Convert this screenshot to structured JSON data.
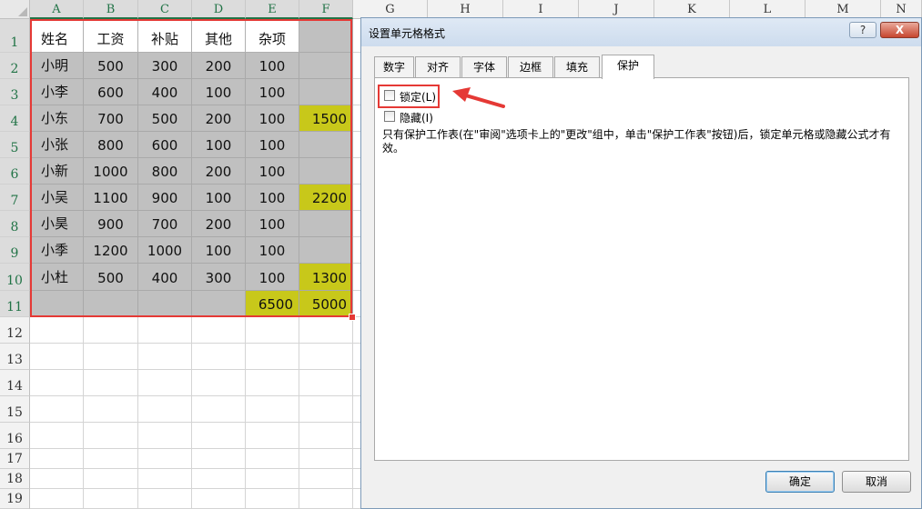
{
  "sheet": {
    "columns": [
      "A",
      "B",
      "C",
      "D",
      "E",
      "F",
      "G",
      "H",
      "I",
      "J",
      "K",
      "L",
      "M",
      "N"
    ],
    "rows": [
      "1",
      "2",
      "3",
      "4",
      "5",
      "6",
      "7",
      "8",
      "9",
      "10",
      "11",
      "12",
      "13",
      "14",
      "15",
      "16",
      "17",
      "18",
      "19"
    ],
    "cells": [
      [
        "姓名",
        "工资",
        "补贴",
        "其他",
        "杂项",
        ""
      ],
      [
        "小明",
        "500",
        "300",
        "200",
        "100",
        ""
      ],
      [
        "小李",
        "600",
        "400",
        "100",
        "100",
        ""
      ],
      [
        "小东",
        "700",
        "500",
        "200",
        "100",
        "1500"
      ],
      [
        "小张",
        "800",
        "600",
        "100",
        "100",
        ""
      ],
      [
        "小新",
        "1000",
        "800",
        "200",
        "100",
        ""
      ],
      [
        "小吴",
        "1100",
        "900",
        "100",
        "100",
        "2200"
      ],
      [
        "小昊",
        "900",
        "700",
        "200",
        "100",
        ""
      ],
      [
        "小季",
        "1200",
        "1000",
        "100",
        "100",
        ""
      ],
      [
        "小杜",
        "500",
        "400",
        "300",
        "100",
        "1300"
      ],
      [
        "",
        "",
        "",
        "",
        "6500",
        "5000"
      ]
    ],
    "colors": {
      "selection_fill": "#c0c0c0",
      "highlight": "#c8c81a",
      "selection_border": "#e53935",
      "arrow": "#e53935"
    }
  },
  "dialog": {
    "title": "设置单元格格式",
    "help": "?",
    "close": "X",
    "tabs": [
      "数字",
      "对齐",
      "字体",
      "边框",
      "填充",
      "保护"
    ],
    "active_tab": "保护",
    "locked_label": "锁定(L)",
    "locked_checked": false,
    "hidden_label": "隐藏(I)",
    "hidden_checked": false,
    "description": "只有保护工作表(在\"审阅\"选项卡上的\"更改\"组中，单击\"保护工作表\"按钮)后，锁定单元格或隐藏公式才有效。",
    "ok": "确定",
    "cancel": "取消"
  }
}
